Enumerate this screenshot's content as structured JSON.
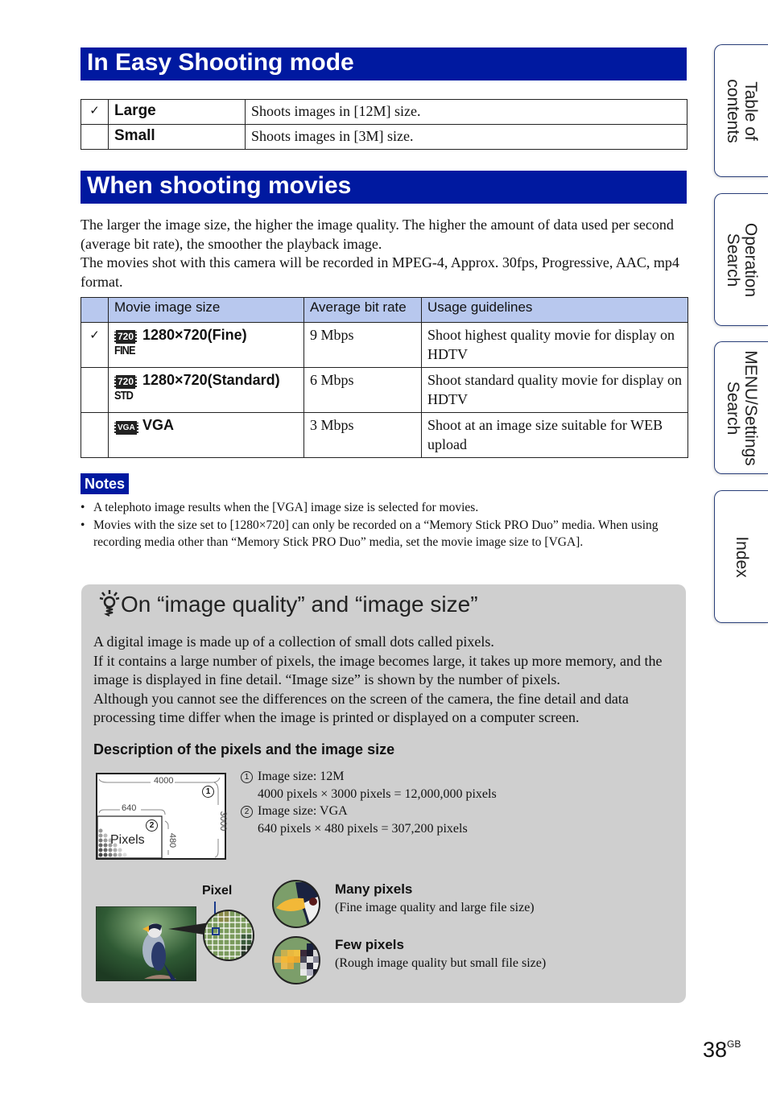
{
  "sections": {
    "easy_title": "In Easy Shooting mode",
    "movies_title": "When shooting movies"
  },
  "easy_table": [
    {
      "checked": true,
      "label": "Large",
      "desc": "Shoots images in [12M] size."
    },
    {
      "checked": false,
      "label": "Small",
      "desc": "Shoots images in [3M] size."
    }
  ],
  "movies_intro": [
    "The larger the image size, the higher the image quality. The higher the amount of data used per second (average bit rate), the smoother the playback image.",
    "The movies shot with this camera will be recorded in MPEG-4, Approx. 30fps, Progressive, AAC, mp4 format."
  ],
  "movie_table": {
    "headers": [
      "Movie image size",
      "Average bit rate",
      "Usage guidelines"
    ],
    "rows": [
      {
        "checked": true,
        "icon_top": "720",
        "icon_sub": "FINE",
        "size": "1280×720(Fine)",
        "rate": "9 Mbps",
        "usage": "Shoot highest quality movie for display on HDTV"
      },
      {
        "checked": false,
        "icon_top": "720",
        "icon_sub": "STD",
        "size": "1280×720(Standard)",
        "rate": "6 Mbps",
        "usage": "Shoot standard quality movie for display on HDTV"
      },
      {
        "checked": false,
        "icon_top": "VGA",
        "icon_sub": "",
        "size": "VGA",
        "rate": "3 Mbps",
        "usage": "Shoot at an image size suitable for WEB upload"
      }
    ]
  },
  "notes": {
    "label": "Notes",
    "items": [
      "A telephoto image results when the [VGA] image size is selected for movies.",
      "Movies with the size set to [1280×720] can only be recorded on a “Memory Stick PRO Duo” media. When using recording media other than “Memory Stick PRO Duo” media, set the movie image size to [VGA]."
    ]
  },
  "tip": {
    "title": "On “image quality” and “image size”",
    "body": [
      "A digital image is made up of a collection of small dots called pixels.",
      "If it contains a large number of pixels, the image becomes large, it takes up more memory, and the image is displayed in fine detail. “Image size” is shown by the number of pixels.",
      "Although you cannot see the differences on the screen of the camera, the fine detail and data processing time differ when the image is printed or displayed on a computer screen."
    ],
    "subheading": "Description of the pixels and the image size",
    "diagram": {
      "width_large": "4000",
      "height_large": "3000",
      "width_small": "640",
      "height_small": "480",
      "pixels_label": "Pixels",
      "marker1": "1",
      "marker2": "2"
    },
    "descriptions": [
      {
        "num": "1",
        "title": "Image size: 12M",
        "calc": "4000 pixels × 3000 pixels = 12,000,000 pixels"
      },
      {
        "num": "2",
        "title": "Image size: VGA",
        "calc": "640 pixels × 480 pixels = 307,200 pixels"
      }
    ],
    "pixel_label": "Pixel",
    "many": {
      "title": "Many pixels",
      "desc": "(Fine image quality and large file size)"
    },
    "few": {
      "title": "Few pixels",
      "desc": "(Rough image quality but small file size)"
    }
  },
  "side_tabs": [
    {
      "line1": "Table of",
      "line2": "contents"
    },
    {
      "line1": "Operation",
      "line2": "Search"
    },
    {
      "line1": "MENU/Settings",
      "line2": "Search"
    },
    {
      "line1": "Index",
      "line2": ""
    }
  ],
  "page": {
    "number": "38",
    "suffix": "GB"
  },
  "colors": {
    "heading_blue": "#0019a0",
    "table_header": "#b8c8ee",
    "tip_bg": "#cfcfcf"
  }
}
